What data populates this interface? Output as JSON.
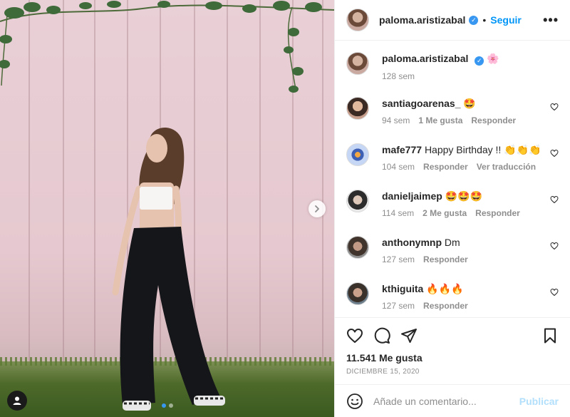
{
  "post": {
    "author": "paloma.aristizabal",
    "follow_label": "Seguir",
    "separator": "•",
    "more_label": "•••",
    "caption": {
      "emoji": "🌸",
      "time": "128 sem"
    },
    "comments": [
      {
        "user": "santiagoarenas_",
        "text": "🤩",
        "time": "94 sem",
        "likes": "1 Me gusta",
        "reply": "Responder",
        "extra": ""
      },
      {
        "user": "mafe777",
        "text": "Happy Birthday !! 👏👏👏",
        "time": "104 sem",
        "likes": "",
        "reply": "Responder",
        "extra": "Ver traducción"
      },
      {
        "user": "danieljaimep",
        "text": "🤩🤩🤩",
        "time": "114 sem",
        "likes": "2 Me gusta",
        "reply": "Responder",
        "extra": ""
      },
      {
        "user": "anthonymnp",
        "text": "Dm",
        "time": "127 sem",
        "likes": "",
        "reply": "Responder",
        "extra": ""
      },
      {
        "user": "kthiguita",
        "text": "🔥🔥🔥",
        "time": "127 sem",
        "likes": "",
        "reply": "Responder",
        "extra": ""
      }
    ],
    "likes_count": "11.541 Me gusta",
    "date": "DICIEMBRE 15, 2020",
    "comment_placeholder": "Añade un comentario...",
    "publish_label": "Publicar",
    "carousel": {
      "slides": 2,
      "active": 0
    },
    "colors": {
      "accent": "#0095f6",
      "verified": "#3897f0",
      "muted": "#8e8e8e",
      "publish_disabled": "#b2dffc"
    }
  }
}
